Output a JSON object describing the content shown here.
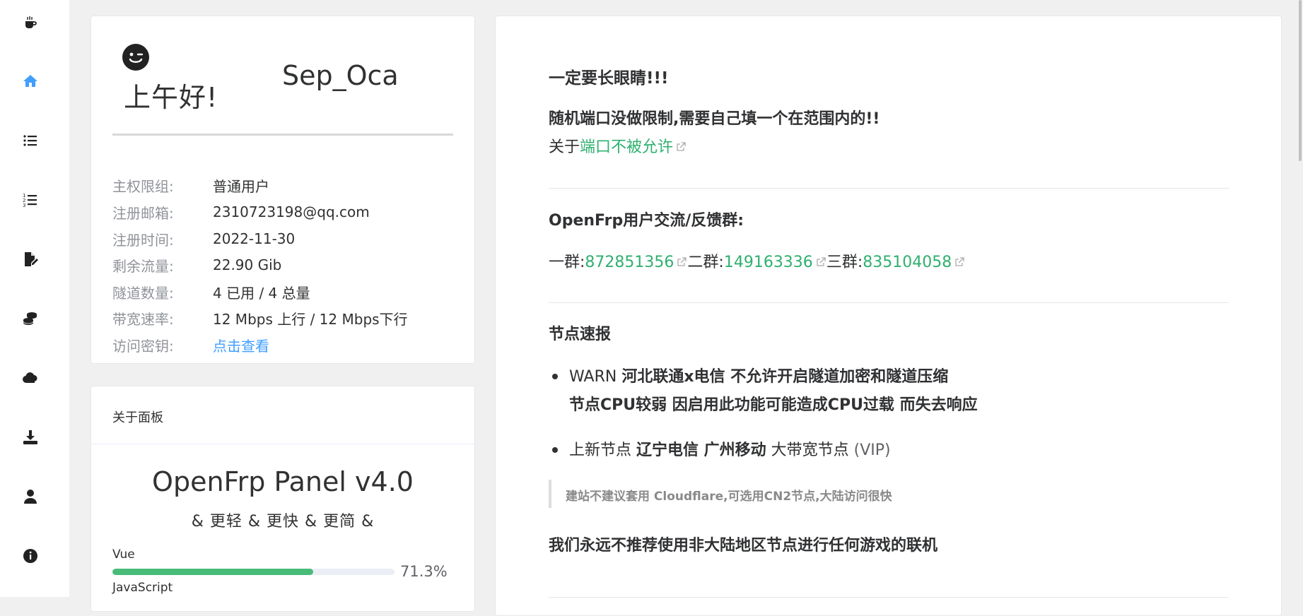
{
  "sidebar": {
    "icons": [
      "coffee-icon",
      "home-icon",
      "list-icon",
      "ordered-list-icon",
      "file-signature-icon",
      "coins-icon",
      "cloud-icon",
      "download-icon",
      "user-icon",
      "info-icon"
    ],
    "active_color": "#409eff"
  },
  "user_card": {
    "greeting": "上午好!",
    "username": "Sep_Oca",
    "rows": [
      {
        "label": "主权限组:",
        "value": "普通用户"
      },
      {
        "label": "注册邮箱:",
        "value": "2310723198@qq.com"
      },
      {
        "label": "注册时间:",
        "value": "2022-11-30"
      },
      {
        "label": "剩余流量:",
        "value": "22.90 Gib"
      },
      {
        "label": "隧道数量:",
        "value": "4 已用 / 4 总量"
      },
      {
        "label": "带宽速率:",
        "value": "12 Mbps 上行 / 12 Mbps下行"
      },
      {
        "label": "访问密钥:",
        "value": "点击查看"
      }
    ]
  },
  "about_card": {
    "header": "关于面板",
    "title": "OpenFrp Panel v4.0",
    "subtitle": "& 更轻 & 更快 & 更简 &",
    "languages": [
      {
        "name": "Vue",
        "percent": 71.3,
        "percent_label": "71.3%"
      },
      {
        "name": "JavaScript"
      }
    ]
  },
  "notice": {
    "warning_title": "一定要长眼睛!!!",
    "random_port": "随机端口没做限制,需要自己填一个在范围内的!!",
    "about_prefix": "关于",
    "about_link": "端口不被允许",
    "group_title": "OpenFrp用户交流/反馈群:",
    "groups": [
      {
        "label": "一群:",
        "number": "872851356"
      },
      {
        "label": "二群:",
        "number": "149163336"
      },
      {
        "label": "三群:",
        "number": "835104058"
      }
    ],
    "node_title": "节点速报",
    "bullet1_line1_prefix": "WARN ",
    "bullet1_line1_bold": "河北联通x电信 不允许开启隧道加密和隧道压缩",
    "bullet1_line2": "节点CPU较弱 因启用此功能可能造成CPU过载 而失去响应",
    "bullet2_prefix": "上新节点 ",
    "bullet2_bold": "辽宁电信 广州移动",
    "bullet2_suffix": " 大带宽节点 ",
    "bullet2_vip": "(VIP)",
    "quote": "建站不建议套用 Cloudflare,可选用CN2节点,大陆访问很快",
    "never_recommend": "我们永远不推荐使用非大陆地区节点进行任何游戏的联机"
  },
  "colors": {
    "green": "#2fb06f",
    "link_blue": "#409eff",
    "progress_green": "#48bb78"
  }
}
